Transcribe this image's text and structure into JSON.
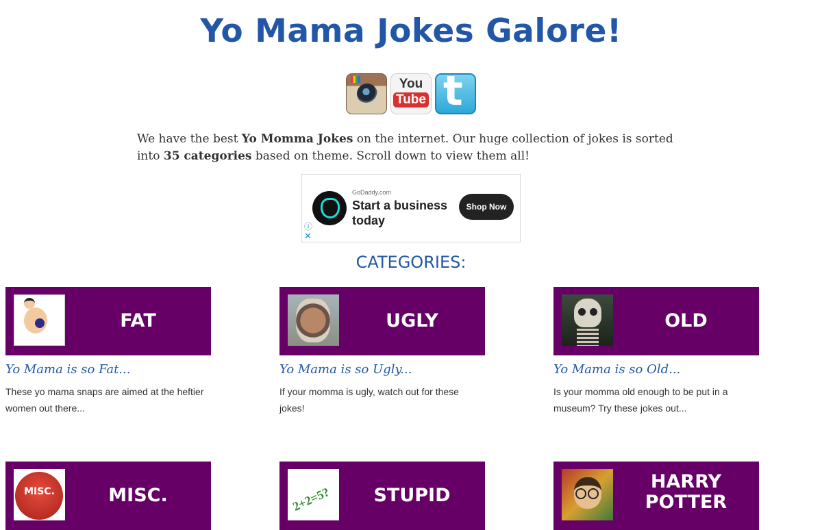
{
  "site": {
    "title": "Yo Mama Jokes Galore!"
  },
  "social": [
    {
      "name": "instagram",
      "icon": "instagram-icon"
    },
    {
      "name": "youtube",
      "icon": "youtube-icon",
      "text_top": "You",
      "text_bottom": "Tube"
    },
    {
      "name": "twitter",
      "icon": "twitter-icon",
      "glyph": "t"
    }
  ],
  "intro": {
    "p1": "We have the best ",
    "bold1": "Yo Momma Jokes",
    "p2": " on the internet. Our huge collection of jokes is sorted into ",
    "bold2": "35 categories",
    "p3": " based on theme. Scroll down to view them all!"
  },
  "ad": {
    "source": "GoDaddy.com",
    "headline": "Start a business today",
    "cta": "Shop Now",
    "info_glyph": "ⓘ",
    "close_glyph": "✕"
  },
  "categories_heading": "CATEGORIES:",
  "categories": [
    {
      "label": "FAT",
      "subtitle": "Yo Mama is so Fat...",
      "description": "These yo mama snaps are aimed at the heftier women out there..."
    },
    {
      "label": "UGLY",
      "subtitle": "Yo Mama is so Ugly...",
      "description": "If your momma is ugly, watch out for these jokes!"
    },
    {
      "label": "OLD",
      "subtitle": "Yo Mama is so Old...",
      "description": "Is your momma old enough to be put in a museum? Try these jokes out..."
    },
    {
      "label": "MISC.",
      "thumb_text": "MISC."
    },
    {
      "label": "STUPID",
      "thumb_text": "2+2=5?"
    },
    {
      "label": "HARRY POTTER"
    }
  ],
  "colors": {
    "brand_blue": "#2257a8",
    "banner_purple": "#660066"
  }
}
